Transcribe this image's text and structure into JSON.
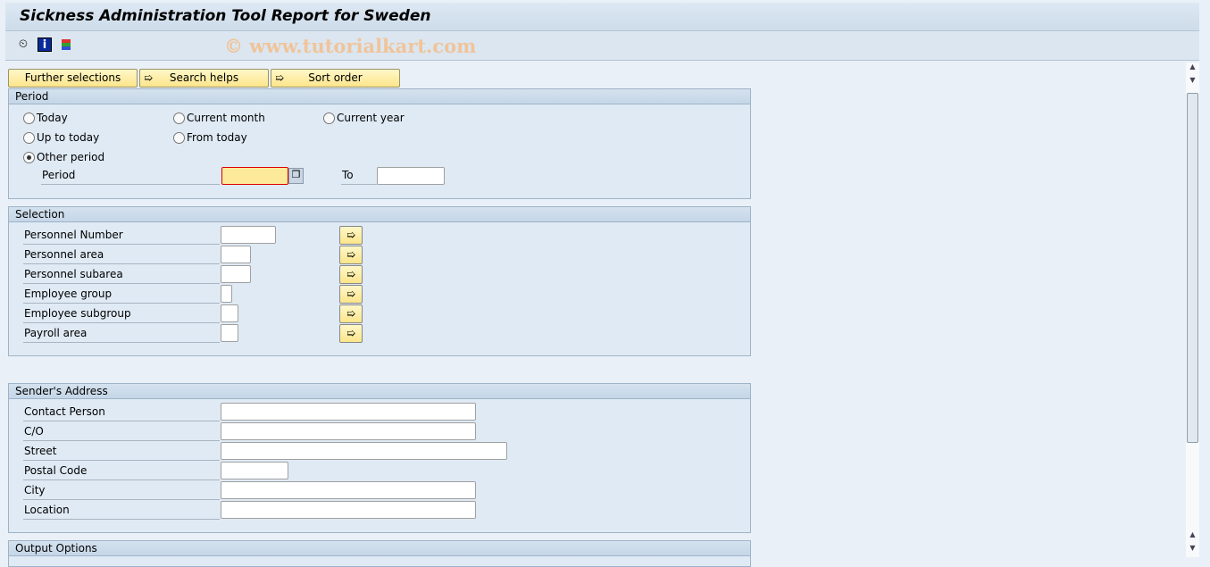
{
  "title": "Sickness Administration Tool Report for Sweden",
  "watermark": "© www.tutorialkart.com",
  "toolbar": {
    "icons": [
      "execute-clock-icon",
      "info-icon",
      "selection-variant-icon"
    ]
  },
  "buttons": {
    "further": "Further selections",
    "search": "Search helps",
    "sort": "Sort order"
  },
  "period": {
    "header": "Period",
    "today": "Today",
    "current_month": "Current month",
    "current_year": "Current year",
    "up_to_today": "Up to today",
    "from_today": "From today",
    "other_period": "Other period",
    "selected": "other_period",
    "period_label": "Period",
    "to_label": "To",
    "period_from": "",
    "period_to": ""
  },
  "selection": {
    "header": "Selection",
    "rows": [
      {
        "label": "Personnel Number",
        "value": ""
      },
      {
        "label": "Personnel area",
        "value": ""
      },
      {
        "label": "Personnel subarea",
        "value": ""
      },
      {
        "label": "Employee group",
        "value": ""
      },
      {
        "label": "Employee subgroup",
        "value": ""
      },
      {
        "label": "Payroll area",
        "value": ""
      }
    ]
  },
  "sender": {
    "header": "Sender's Address",
    "rows": [
      {
        "label": "Contact Person",
        "value": ""
      },
      {
        "label": "C/O",
        "value": ""
      },
      {
        "label": "Street",
        "value": ""
      },
      {
        "label": "Postal Code",
        "value": ""
      },
      {
        "label": "City",
        "value": ""
      },
      {
        "label": "Location",
        "value": ""
      }
    ]
  },
  "output": {
    "header": "Output Options"
  }
}
